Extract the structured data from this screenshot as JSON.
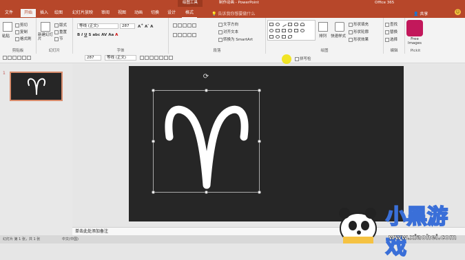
{
  "titlebar": {
    "context_tab": "绘图工具",
    "main_title": "制作动画 - PowerPoint",
    "account": "Office 365"
  },
  "tabs": [
    "文件",
    "开始",
    "插入",
    "绘图",
    "幻灯片放映",
    "审阅",
    "视图",
    "动画",
    "切换",
    "设计",
    "格式"
  ],
  "tell_me": "告诉我你想要做什么",
  "share": "共享",
  "ribbon": {
    "clipboard": {
      "paste": "粘贴",
      "cut": "剪切",
      "copy": "复制",
      "format_painter": "格式刷",
      "label": "剪贴板"
    },
    "slides": {
      "new_slide": "新建幻灯片",
      "layout": "版式",
      "reset": "重置",
      "section": "节",
      "label": "幻灯片"
    },
    "font": {
      "name": "等线 (正文)",
      "size": "287",
      "label": "字体"
    },
    "paragraph": {
      "text_direction": "文字方向",
      "align_text": "对齐文本",
      "smartart": "转换为 SmartArt",
      "label": "段落"
    },
    "drawing": {
      "arrange": "排列",
      "quick_styles": "快速样式",
      "fill": "形状填充",
      "outline": "形状轮廓",
      "effects": "形状效果",
      "label": "绘图"
    },
    "editing": {
      "find": "查找",
      "replace": "替换",
      "select": "选择",
      "label": "编辑"
    },
    "pickit": {
      "btn": "Free Images",
      "label": "Pickit"
    }
  },
  "qat": {
    "size": "287",
    "font": "等线 (正文)",
    "checkbox": "拼写检"
  },
  "slide_number": "1",
  "notes_placeholder": "单击此处添加备注",
  "status": {
    "slide_info": "幻灯片 第 1 张，共 1 张",
    "lang": "中文(中国)"
  },
  "watermark": {
    "brand": "小黑游戏",
    "url": "www.xiaohei.com"
  },
  "colors": {
    "accent": "#b7472a",
    "slide_bg": "#262626"
  }
}
